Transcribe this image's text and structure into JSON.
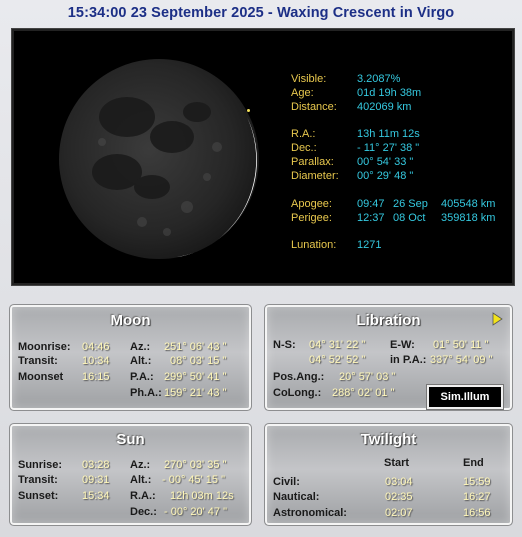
{
  "header": {
    "title": "15:34:00  23 September 2025 - Waxing Crescent in Virgo"
  },
  "moon_info": {
    "visible_label": "Visible:",
    "visible": "3.2087%",
    "age_label": "Age:",
    "age": "01d 19h 38m",
    "distance_label": "Distance:",
    "distance": "402069 km",
    "ra_label": "R.A.:",
    "ra": "13h 11m 12s",
    "dec_label": "Dec.:",
    "dec": "- 11° 27' 38 \"",
    "parallax_label": "Parallax:",
    "parallax": "00° 54' 33 \"",
    "diameter_label": "Diameter:",
    "diameter": "00° 29' 48 \"",
    "apogee_label": "Apogee:",
    "apogee_time": "09:47",
    "apogee_date": "26 Sep",
    "apogee_km": "405548 km",
    "perigee_label": "Perigee:",
    "perigee_time": "12:37",
    "perigee_date": "08 Oct",
    "perigee_km": "359818 km",
    "lunation_label": "Lunation:",
    "lunation": "1271"
  },
  "moon_panel": {
    "title": "Moon",
    "moonrise_label": "Moonrise:",
    "moonrise": "04:46",
    "transit_label": "Transit:",
    "transit": "10:34",
    "moonset_label": "Moonset",
    "moonset": "16:15",
    "az_label": "Az.:",
    "az": "251° 06' 43 \"",
    "alt_label": "Alt.:",
    "alt": "08° 03' 15 \"",
    "pa_label": "P.A.:",
    "pa": "299° 50' 41 \"",
    "pha_label": "Ph.A.:",
    "pha": "159° 21' 43 \""
  },
  "libration_panel": {
    "title": "Libration",
    "ns_label": "N-S:",
    "ns1": "04° 31' 22 \"",
    "ns2": "04° 52' 52 \"",
    "ew_label": "E-W:",
    "ew": "01° 50' 11 \"",
    "inpa_label": "in P.A.:",
    "inpa": "337° 54' 09 \"",
    "posang_label": "Pos.Ang.:",
    "posang": "20° 57' 03 \"",
    "colong_label": "CoLong.:",
    "colong": "288° 02' 01 \"",
    "sim_button": "Sim.Illum"
  },
  "sun_panel": {
    "title": "Sun",
    "sunrise_label": "Sunrise:",
    "sunrise": "03:28",
    "transit_label": "Transit:",
    "transit": "09:31",
    "sunset_label": "Sunset:",
    "sunset": "15:34",
    "az_label": "Az.:",
    "az": "270° 03' 35 \"",
    "alt_label": "Alt.:",
    "alt": "- 00° 45' 15 \"",
    "ra_label": "R.A.:",
    "ra": "12h 03m 12s",
    "dec_label": "Dec.:",
    "dec": "- 00° 20' 47 \""
  },
  "twilight_panel": {
    "title": "Twilight",
    "start_header": "Start",
    "end_header": "End",
    "civil_label": "Civil:",
    "civil_start": "03:04",
    "civil_end": "15:59",
    "nautical_label": "Nautical:",
    "nautical_start": "02:35",
    "nautical_end": "16:27",
    "astro_label": "Astronomical:",
    "astro_start": "02:07",
    "astro_end": "16:56"
  },
  "colors": {
    "title": "#1c2f86",
    "label_yellow": "#e8c84e",
    "value_cyan": "#35c9e0"
  }
}
